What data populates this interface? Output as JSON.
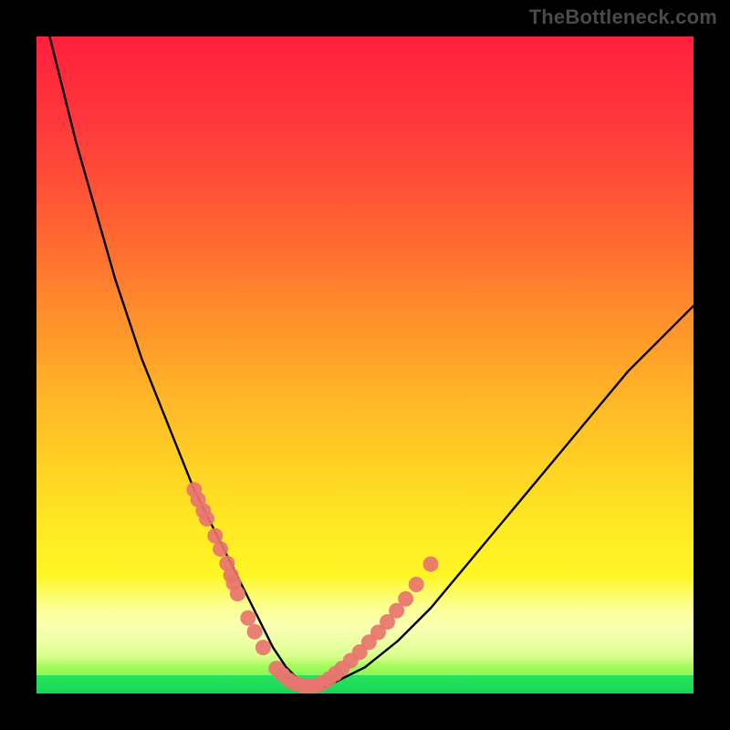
{
  "branding": "TheBottleneck.com",
  "chart_data": {
    "type": "line",
    "title": "",
    "xlabel": "",
    "ylabel": "",
    "xlim": [
      0,
      100
    ],
    "ylim": [
      0,
      100
    ],
    "legend": false,
    "grid": false,
    "annotations": [],
    "series": [
      {
        "name": "bottleneck-curve",
        "color": "#000000",
        "x": [
          2,
          4,
          6,
          8,
          10,
          12,
          14,
          16,
          18,
          20,
          22,
          24,
          26,
          28,
          30,
          32,
          34,
          35,
          36,
          38,
          40,
          42,
          44,
          46,
          50,
          55,
          60,
          65,
          70,
          75,
          80,
          85,
          90,
          95,
          100
        ],
        "y": [
          100,
          92,
          84,
          77,
          70,
          63,
          57,
          51,
          46,
          41,
          36,
          31,
          27,
          23,
          19,
          15,
          11,
          9,
          7,
          4,
          2,
          1,
          1,
          2,
          4,
          8,
          13,
          19,
          25,
          31,
          37,
          43,
          49,
          54,
          59
        ]
      }
    ],
    "dot_clusters": [
      {
        "name": "left-cluster",
        "color": "#e8746f",
        "points": [
          {
            "x": 24.0,
            "y": 31.0
          },
          {
            "x": 24.6,
            "y": 29.5
          },
          {
            "x": 25.4,
            "y": 27.8
          },
          {
            "x": 25.9,
            "y": 26.6
          },
          {
            "x": 27.2,
            "y": 24.0
          },
          {
            "x": 28.0,
            "y": 22.0
          },
          {
            "x": 29.0,
            "y": 19.8
          },
          {
            "x": 29.6,
            "y": 18.0
          },
          {
            "x": 30.0,
            "y": 16.8
          },
          {
            "x": 30.6,
            "y": 15.2
          },
          {
            "x": 32.2,
            "y": 11.5
          },
          {
            "x": 33.2,
            "y": 9.4
          },
          {
            "x": 34.5,
            "y": 7.0
          }
        ]
      },
      {
        "name": "valley-cluster",
        "color": "#e8746f",
        "points": [
          {
            "x": 36.5,
            "y": 3.8
          },
          {
            "x": 37.5,
            "y": 2.8
          },
          {
            "x": 38.5,
            "y": 2.0
          },
          {
            "x": 39.5,
            "y": 1.5
          },
          {
            "x": 40.5,
            "y": 1.2
          },
          {
            "x": 41.5,
            "y": 1.1
          },
          {
            "x": 42.5,
            "y": 1.2
          },
          {
            "x": 43.5,
            "y": 1.6
          },
          {
            "x": 44.5,
            "y": 2.2
          }
        ]
      },
      {
        "name": "right-cluster",
        "color": "#e8746f",
        "points": [
          {
            "x": 45.5,
            "y": 3.0
          },
          {
            "x": 46.5,
            "y": 3.8
          },
          {
            "x": 47.8,
            "y": 5.0
          },
          {
            "x": 49.2,
            "y": 6.3
          },
          {
            "x": 50.6,
            "y": 7.8
          },
          {
            "x": 52.0,
            "y": 9.3
          },
          {
            "x": 53.4,
            "y": 10.9
          },
          {
            "x": 54.8,
            "y": 12.6
          },
          {
            "x": 56.2,
            "y": 14.4
          },
          {
            "x": 57.8,
            "y": 16.6
          },
          {
            "x": 60.0,
            "y": 19.7
          }
        ]
      }
    ]
  }
}
